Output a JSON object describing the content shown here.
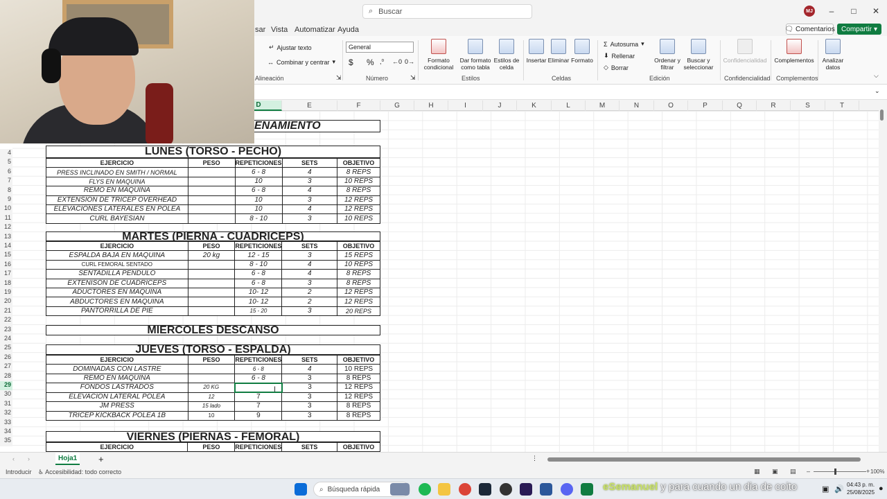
{
  "search": {
    "placeholder": "Buscar"
  },
  "user": {
    "initials": "MJ"
  },
  "menu": {
    "items": [
      "sar",
      "Vista",
      "Automatizar",
      "Ayuda"
    ]
  },
  "actions": {
    "comments": "Comentarios",
    "share": "Compartir"
  },
  "ribbon": {
    "wrap_text": "Ajustar texto",
    "merge_center": "Combinar y centrar",
    "align_group": "Alineación",
    "number_format": "General",
    "currency": "$",
    "percent": "%",
    "number_group": "Número",
    "cond_format": "Formato condicional",
    "format_table": "Dar formato como tabla",
    "cell_styles": "Estilos de celda",
    "styles_group": "Estilos",
    "insert": "Insertar",
    "delete": "Eliminar",
    "format": "Formato",
    "cells_group": "Celdas",
    "autosum": "Autosuma",
    "fill": "Rellenar",
    "clear": "Borrar",
    "sort_filter": "Ordenar y filtrar",
    "find_select": "Buscar y seleccionar",
    "edit_group": "Edición",
    "confidentiality": "Confidencialidad",
    "confidentiality_group": "Confidencialidad",
    "addins": "Complementos",
    "addins_group": "Complementos",
    "analyze": "Analizar datos"
  },
  "columns": [
    "D",
    "E",
    "F",
    "G",
    "H",
    "I",
    "J",
    "K",
    "L",
    "M",
    "N",
    "O",
    "P",
    "Q",
    "R",
    "S",
    "T"
  ],
  "rows": [
    "4",
    "5",
    "6",
    "7",
    "8",
    "9",
    "10",
    "11",
    "12",
    "13",
    "14",
    "15",
    "16",
    "17",
    "18",
    "19",
    "20",
    "21",
    "22",
    "23",
    "24",
    "25",
    "26",
    "27",
    "28",
    "29",
    "30",
    "31",
    "32",
    "33",
    "34",
    "35"
  ],
  "sheet_title": "ENAMIENTO",
  "headers": [
    "EJERCICIO",
    "PESO",
    "REPETICIONES",
    "SETS",
    "OBJETIVO"
  ],
  "days": [
    {
      "title": "LUNES (TORSO - PECHO)",
      "rows": [
        [
          "PRESS INCLINADO EN SMITH / NORMAL",
          "",
          "6 - 8",
          "4",
          "8 REPS"
        ],
        [
          "FLYS EN MAQUINA",
          "",
          "10",
          "3",
          "10 REPS"
        ],
        [
          "REMO EN MAQUINA",
          "",
          "6 - 8",
          "4",
          "8 REPS"
        ],
        [
          "EXTENSION DE TRICEP OVERHEAD",
          "",
          "10",
          "3",
          "12 REPS"
        ],
        [
          "ELEVACIONES LATERALES EN POLEA",
          "",
          "10",
          "4",
          "12 REPS"
        ],
        [
          "CURL BAYESIAN",
          "",
          "8 - 10",
          "3",
          "10 REPS"
        ]
      ]
    },
    {
      "title": "MARTES (PIERNA - CUADRICEPS)",
      "rows": [
        [
          "ESPALDA BAJA EN MAQUINA",
          "20 kg",
          "12 - 15",
          "3",
          "15 REPS"
        ],
        [
          "CURL FEMORAL SENTADO",
          "",
          "8 - 10",
          "4",
          "10 REPS"
        ],
        [
          "SENTADILLA PENDULO",
          "",
          "6 - 8",
          "4",
          "8 REPS"
        ],
        [
          "EXTENISON DE CUADRICEPS",
          "",
          "6 - 8",
          "3",
          "8 REPS"
        ],
        [
          "ADUCTORES EN MAQUINA",
          "",
          "10- 12",
          "2",
          "12 REPS"
        ],
        [
          "ABDUCTORES EN MAQUINA",
          "",
          "10- 12",
          "2",
          "12 REPS"
        ],
        [
          "PANTORRILLA DE PIE",
          "",
          "15 - 20",
          "3",
          "20 REPS"
        ]
      ]
    },
    {
      "title": "MIERCOLES DESCANSO"
    },
    {
      "title": "JUEVES (TORSO - ESPALDA)",
      "rows": [
        [
          "DOMINADAS CON LASTRE",
          "",
          "6 - 8",
          "4",
          "10 REPS"
        ],
        [
          "REMO EN MAQUINA",
          "",
          "6 - 8",
          "3",
          "8 REPS"
        ],
        [
          "FONDOS LASTRADOS",
          "20 KG",
          "",
          "3",
          "12 REPS"
        ],
        [
          "ELEVACION LATERAL POLEA",
          "12",
          "7",
          "3",
          "12 REPS"
        ],
        [
          "JM PRESS",
          "15 lado",
          "7",
          "3",
          "8 REPS"
        ],
        [
          "TRICEP KICKBACK POLEA 1B",
          "10",
          "9",
          "3",
          "8 REPS"
        ]
      ]
    },
    {
      "title": "VIERNES (PIERNAS - FEMORAL)"
    }
  ],
  "sheet_tab": "Hoja1",
  "status": {
    "mode": "Introducir",
    "accessibility": "Accesibilidad: todo correcto",
    "zoom": "100%"
  },
  "taskbar": {
    "search_placeholder": "Búsqueda rápida",
    "overlay_handle": "eSemanuel",
    "overlay_message": "y para cuando un dia de coito",
    "time": "04:43 p. m.",
    "date": "25/08/2025"
  },
  "colors": {
    "accent": "#107c41",
    "selection": "#d3f0e0"
  }
}
